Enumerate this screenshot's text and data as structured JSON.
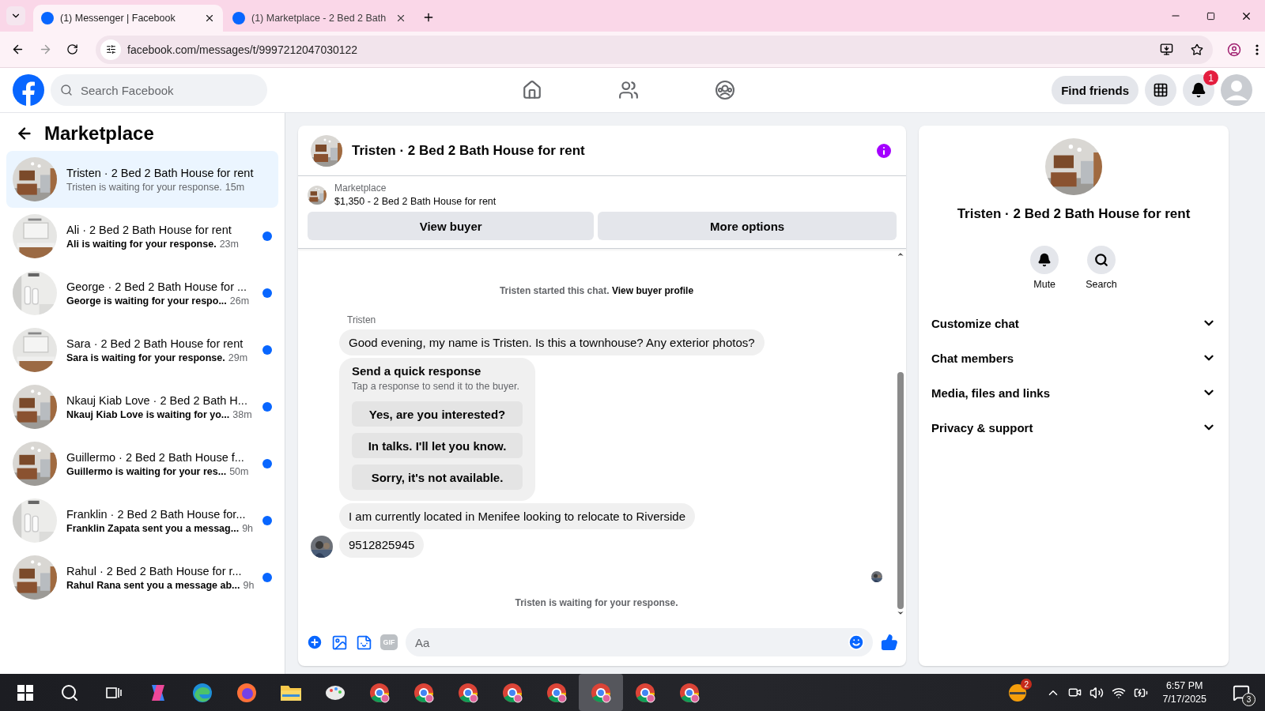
{
  "browser": {
    "tabs": [
      {
        "title": "(1) Messenger | Facebook",
        "selected": true
      },
      {
        "title": "(1) Marketplace - 2 Bed 2 Bath",
        "selected": false
      }
    ],
    "url": "facebook.com/messages/t/9997212047030122"
  },
  "header": {
    "search_placeholder": "Search Facebook",
    "find_friends": "Find friends",
    "notification_count": "1"
  },
  "sidebar": {
    "title": "Marketplace",
    "conversations": [
      {
        "title": "Tristen · 2 Bed 2 Bath House for rent",
        "preview": "Tristen is waiting for your response.",
        "time": "15m",
        "unread": false,
        "selected": true
      },
      {
        "title": "Ali · 2 Bed 2 Bath House for rent",
        "preview": "Ali is waiting for your response.",
        "time": "23m",
        "unread": true,
        "selected": false
      },
      {
        "title": "George · 2 Bed 2 Bath House for ...",
        "preview": "George is waiting for your respo...",
        "time": "26m",
        "unread": true,
        "selected": false
      },
      {
        "title": "Sara · 2 Bed 2 Bath House for rent",
        "preview": "Sara is waiting for your response.",
        "time": "29m",
        "unread": true,
        "selected": false
      },
      {
        "title": "Nkauj Kiab Love · 2 Bed 2 Bath H...",
        "preview": "Nkauj Kiab Love is waiting for yo...",
        "time": "38m",
        "unread": true,
        "selected": false
      },
      {
        "title": "Guillermo · 2 Bed 2 Bath House f...",
        "preview": "Guillermo is waiting for your res...",
        "time": "50m",
        "unread": true,
        "selected": false
      },
      {
        "title": "Franklin · 2 Bed 2 Bath House for...",
        "preview": "Franklin Zapata sent you a messag...",
        "time": "9h",
        "unread": true,
        "selected": false
      },
      {
        "title": "Rahul · 2 Bed 2 Bath House for r...",
        "preview": "Rahul Rana sent you a message ab...",
        "time": "9h",
        "unread": true,
        "selected": false
      }
    ]
  },
  "chat": {
    "title": "Tristen · 2 Bed 2 Bath House for rent",
    "listing_label": "Marketplace",
    "listing_title": "$1,350 - 2 Bed 2 Bath House for rent",
    "buttons": [
      "View buyer",
      "More options"
    ],
    "started": "Tristen started this chat.",
    "profile_link": "View buyer profile",
    "sender": "Tristen",
    "messages": [
      {
        "kind": "text",
        "text": "Good evening, my name is Tristen. Is this a townhouse? Any exterior photos?",
        "avatar": false
      },
      {
        "kind": "quick_response",
        "title": "Send a quick response",
        "subtitle": "Tap a response to send it to the buyer.",
        "options": [
          "Yes, are you interested?",
          "In talks. I'll let you know.",
          "Sorry, it's not available."
        ]
      },
      {
        "kind": "text",
        "text": "I am currently located in Menifee looking to relocate to Riverside",
        "avatar": false
      },
      {
        "kind": "text",
        "text": "9512825945",
        "avatar": true
      }
    ],
    "status": "Tristen is waiting for your response.",
    "gif_label": "GIF",
    "composer_placeholder": "Aa"
  },
  "details": {
    "title": "Tristen · 2 Bed 2 Bath House for rent",
    "actions": [
      {
        "kind": "mute",
        "label": "Mute"
      },
      {
        "kind": "search",
        "label": "Search"
      }
    ],
    "sections": [
      "Customize chat",
      "Chat members",
      "Media, files and links",
      "Privacy & support"
    ]
  },
  "taskbar": {
    "apps": [
      {
        "kind": "copilot",
        "selected": false
      },
      {
        "kind": "edge",
        "selected": false
      },
      {
        "kind": "firefox",
        "selected": false
      },
      {
        "kind": "folder",
        "selected": false
      },
      {
        "kind": "paint",
        "selected": false
      },
      {
        "kind": "chrome",
        "selected": false
      },
      {
        "kind": "chrome",
        "selected": false
      },
      {
        "kind": "chrome",
        "selected": false
      },
      {
        "kind": "chrome",
        "selected": false
      },
      {
        "kind": "chrome",
        "selected": false
      },
      {
        "kind": "chrome",
        "selected": true
      },
      {
        "kind": "chrome",
        "selected": false
      },
      {
        "kind": "chrome",
        "selected": false
      }
    ],
    "weather_badge": "2",
    "time": "6:57 PM",
    "date": "7/17/2025",
    "notification_count": "3"
  }
}
